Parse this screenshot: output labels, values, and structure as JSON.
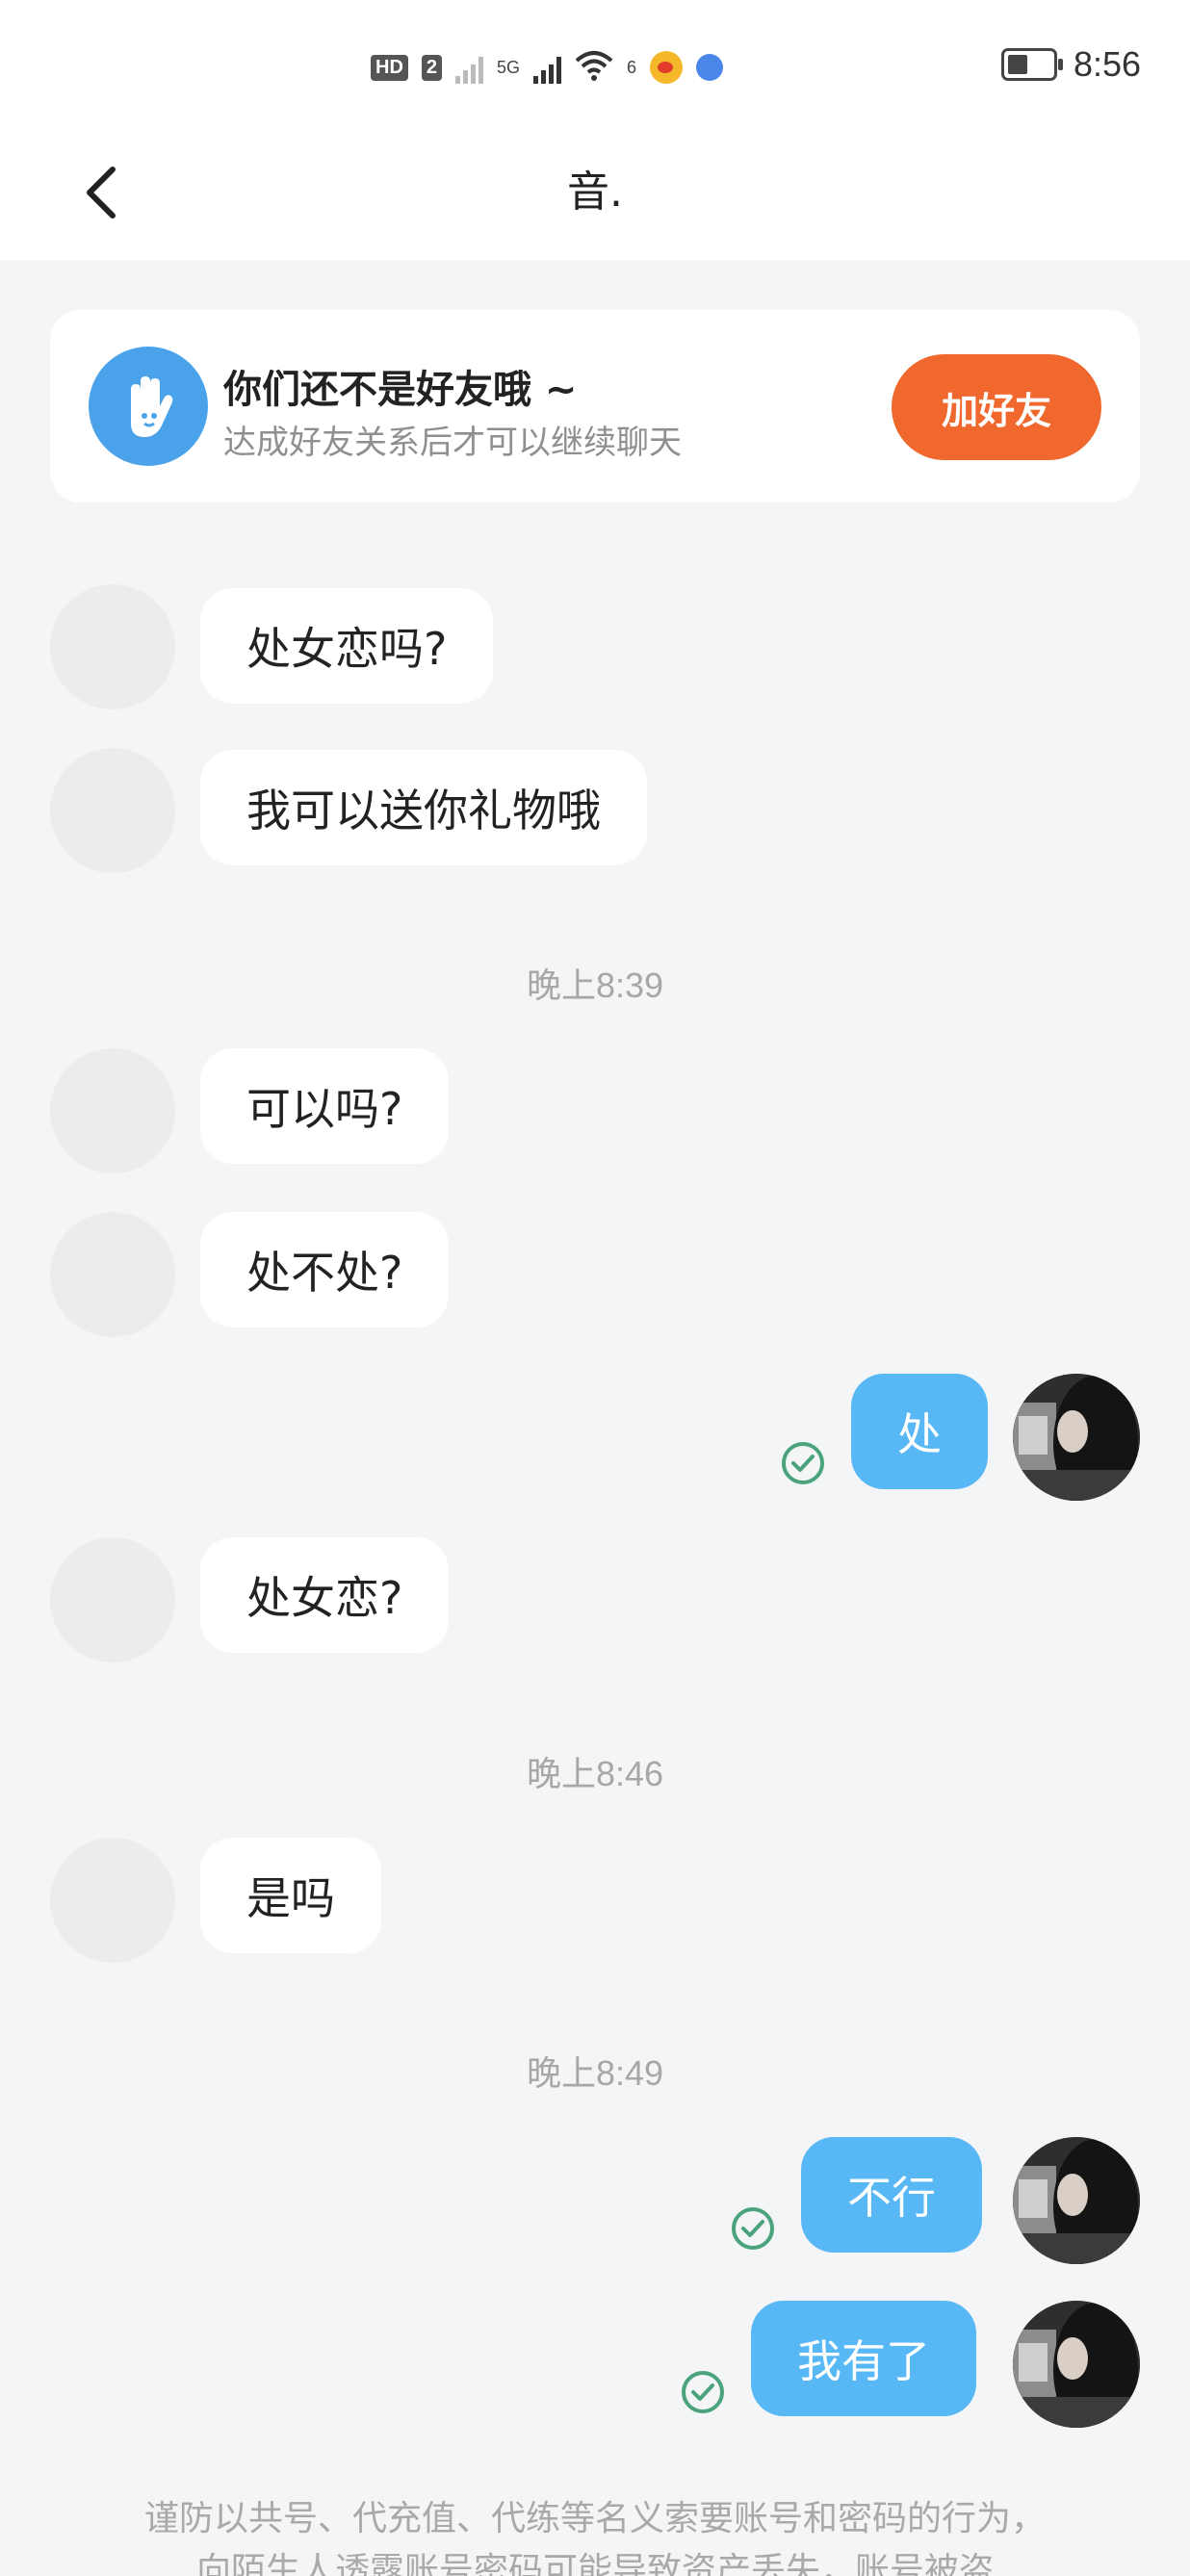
{
  "status_bar": {
    "hd_label": "HD",
    "sim_label": "2",
    "network_label": "5G",
    "wifi_label": "6",
    "time": "8:56"
  },
  "header": {
    "title": "音."
  },
  "friend_notice": {
    "title": "你们还不是好友哦 ~",
    "subtitle": "达成好友关系后才可以继续聊天",
    "button_label": "加好友",
    "accent_color": "#f0682e"
  },
  "messages": {
    "m1": "处女恋吗?",
    "m2": "我可以送你礼物哦",
    "t1": "晚上8:39",
    "m3": "可以吗?",
    "m4": "处不处?",
    "m5": "处",
    "m6": "处女恋?",
    "t2": "晚上8:46",
    "m7": "是吗",
    "t3": "晚上8:49",
    "m8": "不行",
    "m9": "我有了"
  },
  "colors": {
    "outgoing_bubble": "#58b8f6",
    "read_check": "#4aa37c"
  },
  "warning": {
    "line1": "谨防以共号、代充值、代练等名义索要账号和密码的行为，",
    "line2": "向陌生人透露账号密码可能导致资产丢失，账号被盗"
  }
}
